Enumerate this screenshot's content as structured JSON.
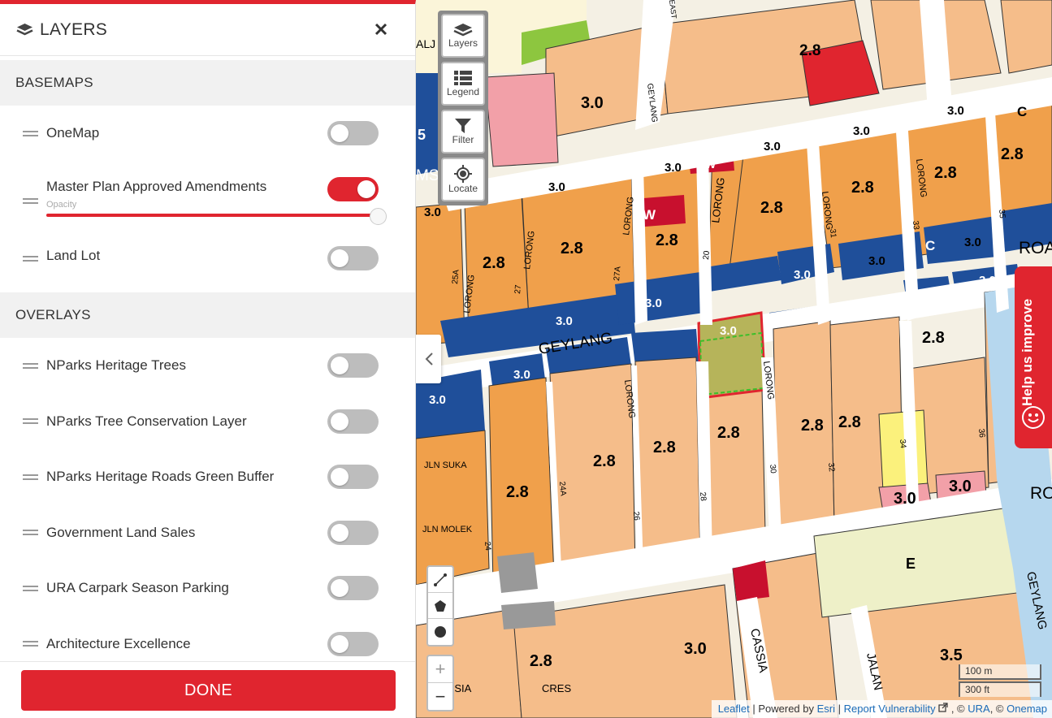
{
  "panel": {
    "title": "LAYERS",
    "basemaps_heading": "BASEMAPS",
    "basemaps": [
      {
        "label": "OneMap",
        "enabled": false
      },
      {
        "label": "Master Plan Approved Amendments",
        "enabled": true,
        "opacity_label": "Opacity",
        "opacity": 1.0
      },
      {
        "label": "Land Lot",
        "enabled": false
      }
    ],
    "overlays_heading": "OVERLAYS",
    "overlays": [
      {
        "label": "NParks Heritage Trees",
        "enabled": false
      },
      {
        "label": "NParks Tree Conservation Layer",
        "enabled": false
      },
      {
        "label": "NParks Heritage Roads Green Buffer",
        "enabled": false
      },
      {
        "label": "Government Land Sales",
        "enabled": false
      },
      {
        "label": "URA Carpark Season Parking",
        "enabled": false
      },
      {
        "label": "Architecture Excellence",
        "enabled": false
      }
    ],
    "done_label": "DONE"
  },
  "map": {
    "tools": [
      {
        "label": "Layers",
        "icon": "layers-icon"
      },
      {
        "label": "Legend",
        "icon": "legend-icon"
      },
      {
        "label": "Filter",
        "icon": "filter-icon"
      },
      {
        "label": "Locate",
        "icon": "locate-icon"
      }
    ],
    "draw_tools": [
      "line-draw-icon",
      "polygon-draw-icon",
      "circle-draw-icon"
    ],
    "zoom_in": "+",
    "zoom_out": "−",
    "feedback_label": "Help us improve",
    "scale": {
      "metric": "100 m",
      "imperial": "300 ft"
    },
    "attribution": {
      "leaflet": "Leaflet",
      "sep1": " | Powered by ",
      "esri": "Esri",
      "sep2": " | ",
      "report": "Report Vulnerability",
      "sep3": " , © ",
      "ura": "URA",
      "sep4": ", © ",
      "onemap": "Onemap"
    },
    "labels": {
      "plot_ratios": [
        "3.0",
        "2.8",
        "3.0",
        "3.0",
        "2.8",
        "3.0",
        "2.8",
        "3.0",
        "2.8",
        "2.8",
        "3.0",
        "3.0",
        "2.8",
        "3.0",
        "3.0",
        "2.8",
        "2.8",
        "3.0",
        "3.0",
        "3.0",
        "3.0",
        "2.8",
        "2.8",
        "2.8",
        "3.0",
        "3.0",
        "2.8",
        "2.8",
        "2.8",
        "3.0",
        "2.8",
        "3.0",
        "3.5",
        "3.0",
        "3.0",
        "3.0",
        "2.8"
      ],
      "streets": [
        "GEYLANG",
        "GEYLANG",
        "LORONG",
        "LORONG",
        "LORONG",
        "LORONG",
        "LORONG",
        "LORONG",
        "LORONG",
        "LORONG",
        "CASSIA",
        "JALAN",
        "ROA",
        "RO",
        "JLN  SUKA",
        "JLN  MOLEK",
        "ASSIA",
        "CRES",
        "MS",
        "GEYLANG",
        "EAST",
        "ALJ"
      ],
      "street_numbers": [
        "25A",
        "27",
        "27A",
        "20",
        "31",
        "33",
        "35",
        "24A",
        "26",
        "28",
        "30",
        "32",
        "34",
        "36",
        "24"
      ],
      "zones": [
        "W",
        "W",
        "C",
        "C",
        "C",
        "E",
        "5",
        "0"
      ]
    },
    "colors": {
      "residential": "#f0a04b",
      "residential_light": "#f5bd8a",
      "commercial_blue": "#1f4f9a",
      "selected_red": "#e0252f",
      "park_green": "#8dc63f",
      "yellow": "#fbf17c",
      "pink": "#f2a0a8"
    }
  }
}
